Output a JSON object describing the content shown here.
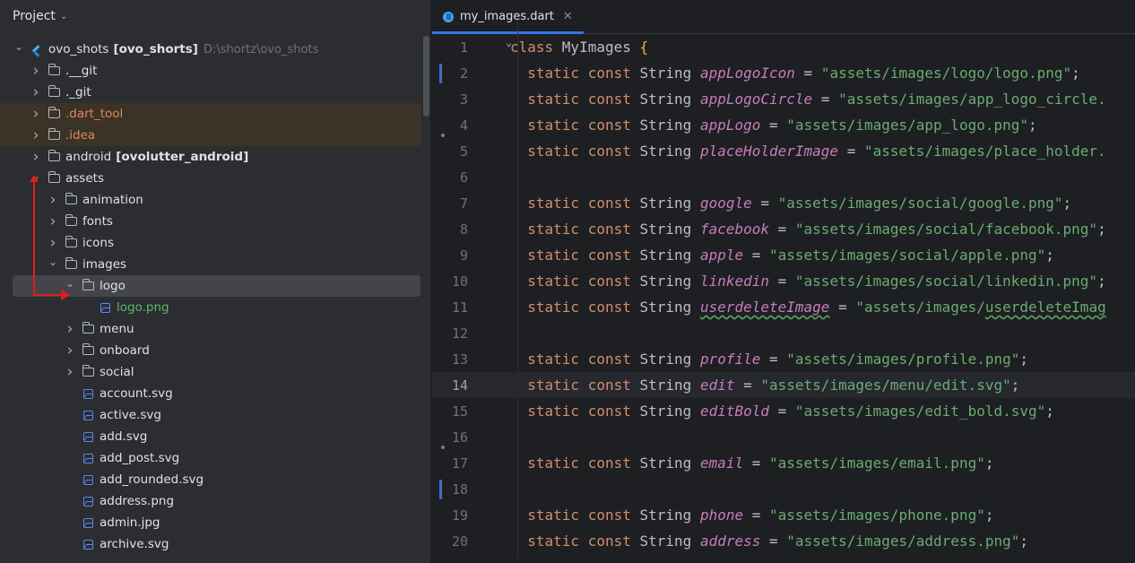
{
  "project_panel": {
    "title": "Project",
    "tree": [
      {
        "indent": 0,
        "arrow": "down",
        "icon": "flutter",
        "label": "ovo_shots",
        "label_bold": "[ovo_shorts]",
        "path": "D:\\shortz\\ovo_shots"
      },
      {
        "indent": 1,
        "arrow": "right",
        "icon": "folder",
        "label": ".__git"
      },
      {
        "indent": 1,
        "arrow": "right",
        "icon": "folder",
        "label": "._git"
      },
      {
        "indent": 1,
        "arrow": "right",
        "icon": "folder",
        "label": ".dart_tool",
        "color": "orange",
        "highlight": true
      },
      {
        "indent": 1,
        "arrow": "right",
        "icon": "folder-gear",
        "label": ".idea",
        "color": "orange",
        "highlight": true
      },
      {
        "indent": 1,
        "arrow": "right",
        "icon": "folder",
        "label": "android",
        "label_bold": "[ovolutter_android]"
      },
      {
        "indent": 1,
        "arrow": "down",
        "icon": "folder",
        "label": "assets"
      },
      {
        "indent": 2,
        "arrow": "right",
        "icon": "folder",
        "label": "animation"
      },
      {
        "indent": 2,
        "arrow": "right",
        "icon": "folder",
        "label": "fonts"
      },
      {
        "indent": 2,
        "arrow": "right",
        "icon": "folder",
        "label": "icons"
      },
      {
        "indent": 2,
        "arrow": "down",
        "icon": "folder",
        "label": "images"
      },
      {
        "indent": 3,
        "arrow": "down",
        "icon": "folder",
        "label": "logo",
        "selected": true
      },
      {
        "indent": 4,
        "arrow": "",
        "icon": "image",
        "label": "logo.png",
        "color": "green"
      },
      {
        "indent": 3,
        "arrow": "right",
        "icon": "folder",
        "label": "menu"
      },
      {
        "indent": 3,
        "arrow": "right",
        "icon": "folder",
        "label": "onboard"
      },
      {
        "indent": 3,
        "arrow": "right",
        "icon": "folder",
        "label": "social"
      },
      {
        "indent": 3,
        "arrow": "",
        "icon": "image",
        "label": "account.svg"
      },
      {
        "indent": 3,
        "arrow": "",
        "icon": "image",
        "label": "active.svg"
      },
      {
        "indent": 3,
        "arrow": "",
        "icon": "image",
        "label": "add.svg"
      },
      {
        "indent": 3,
        "arrow": "",
        "icon": "image",
        "label": "add_post.svg"
      },
      {
        "indent": 3,
        "arrow": "",
        "icon": "image",
        "label": "add_rounded.svg"
      },
      {
        "indent": 3,
        "arrow": "",
        "icon": "image",
        "label": "address.png"
      },
      {
        "indent": 3,
        "arrow": "",
        "icon": "image",
        "label": "admin.jpg"
      },
      {
        "indent": 3,
        "arrow": "",
        "icon": "image",
        "label": "archive.svg"
      }
    ]
  },
  "editor": {
    "tab_label": "my_images.dart",
    "current_line": 14,
    "lines": [
      {
        "n": "1",
        "class_decl": true,
        "text": "MyImages"
      },
      {
        "n": "2",
        "field": "appLogoIcon",
        "value": "\"assets/images/logo/logo.png\";"
      },
      {
        "n": "3",
        "field": "appLogoCircle",
        "value": "\"assets/images/app_logo_circle."
      },
      {
        "n": "4",
        "field": "appLogo",
        "value": "\"assets/images/app_logo.png\";"
      },
      {
        "n": "5",
        "field": "placeHolderImage",
        "value": "\"assets/images/place_holder."
      },
      {
        "n": "6"
      },
      {
        "n": "7",
        "field": "google",
        "value": "\"assets/images/social/google.png\";"
      },
      {
        "n": "8",
        "field": "facebook",
        "value": "\"assets/images/social/facebook.png\";"
      },
      {
        "n": "9",
        "field": "apple",
        "value": "\"assets/images/social/apple.png\";"
      },
      {
        "n": "10",
        "field": "linkedin",
        "value": "\"assets/images/social/linkedin.png\";"
      },
      {
        "n": "11",
        "field": "userdeleteImage",
        "value": "\"assets/images/userdeleteImag",
        "wavy": true
      },
      {
        "n": "12"
      },
      {
        "n": "13",
        "field": "profile",
        "value": "\"assets/images/profile.png\";"
      },
      {
        "n": "14",
        "field": "edit",
        "value": "\"assets/images/menu/edit.svg\";"
      },
      {
        "n": "15",
        "field": "editBold",
        "value": "\"assets/images/edit_bold.svg\";"
      },
      {
        "n": "16"
      },
      {
        "n": "17",
        "field": "email",
        "value": "\"assets/images/email.png\";"
      },
      {
        "n": "18"
      },
      {
        "n": "19",
        "field": "phone",
        "value": "\"assets/images/phone.png\";"
      },
      {
        "n": "20",
        "field": "address",
        "value": "\"assets/images/address.png\";"
      }
    ],
    "keywords": {
      "class": "class",
      "static": "static",
      "const": "const",
      "type": "String",
      "eq": "=",
      "open_brace": "{"
    }
  }
}
